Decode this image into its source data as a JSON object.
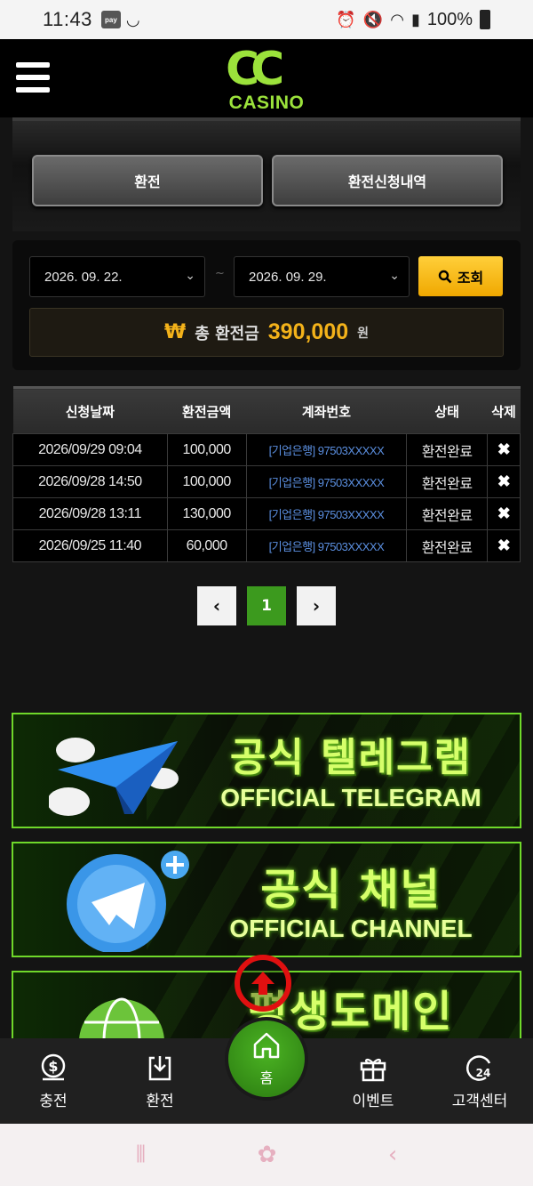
{
  "status_bar": {
    "time": "11:43",
    "pay_label": "pay",
    "battery": "100%"
  },
  "header": {
    "logo_mark": "CC",
    "logo_text": "CASINO"
  },
  "tabs": [
    {
      "label": "환전"
    },
    {
      "label": "환전신청내역"
    }
  ],
  "search": {
    "start_date": "2026. 09. 22.",
    "end_date": "2026. 09. 29.",
    "separator": "~",
    "button_label": "조회",
    "total_symbol": "₩",
    "total_label": "총 환전금",
    "total_amount": "390,000",
    "total_unit": "원"
  },
  "table": {
    "headers": [
      "신청날짜",
      "환전금액",
      "계좌번호",
      "상태",
      "삭제"
    ],
    "rows": [
      {
        "date": "2026/09/29 09:04",
        "amount": "100,000",
        "account": "[기업은행] 97503XXXXX",
        "status": "환전완료",
        "delete": "✖"
      },
      {
        "date": "2026/09/28 14:50",
        "amount": "100,000",
        "account": "[기업은행] 97503XXXXX",
        "status": "환전완료",
        "delete": "✖"
      },
      {
        "date": "2026/09/28 13:11",
        "amount": "130,000",
        "account": "[기업은행] 97503XXXXX",
        "status": "환전완료",
        "delete": "✖"
      },
      {
        "date": "2026/09/25 11:40",
        "amount": "60,000",
        "account": "[기업은행] 97503XXXXX",
        "status": "환전완료",
        "delete": "✖"
      }
    ]
  },
  "pagination": {
    "prev": "‹",
    "current": "1",
    "next": "›"
  },
  "banners": [
    {
      "title_ko": "공식 텔레그램",
      "title_en": "OFFICIAL TELEGRAM"
    },
    {
      "title_ko": "공식 채널",
      "title_en": "OFFICIAL CHANNEL"
    },
    {
      "title_ko": "평생도메인",
      "title_en": ""
    }
  ],
  "bottom_nav": [
    {
      "label": "충전",
      "icon": "dollar-coin-icon"
    },
    {
      "label": "환전",
      "icon": "download-icon"
    },
    {
      "label": "홈",
      "icon": "home-icon"
    },
    {
      "label": "이벤트",
      "icon": "gift-icon"
    },
    {
      "label": "고객센터",
      "icon": "support-24-icon"
    }
  ],
  "colors": {
    "accent_green": "#3c9a1e",
    "brand_lime": "#9be23b",
    "gold": "#f3b21a",
    "account_link": "#5b8fe0"
  }
}
